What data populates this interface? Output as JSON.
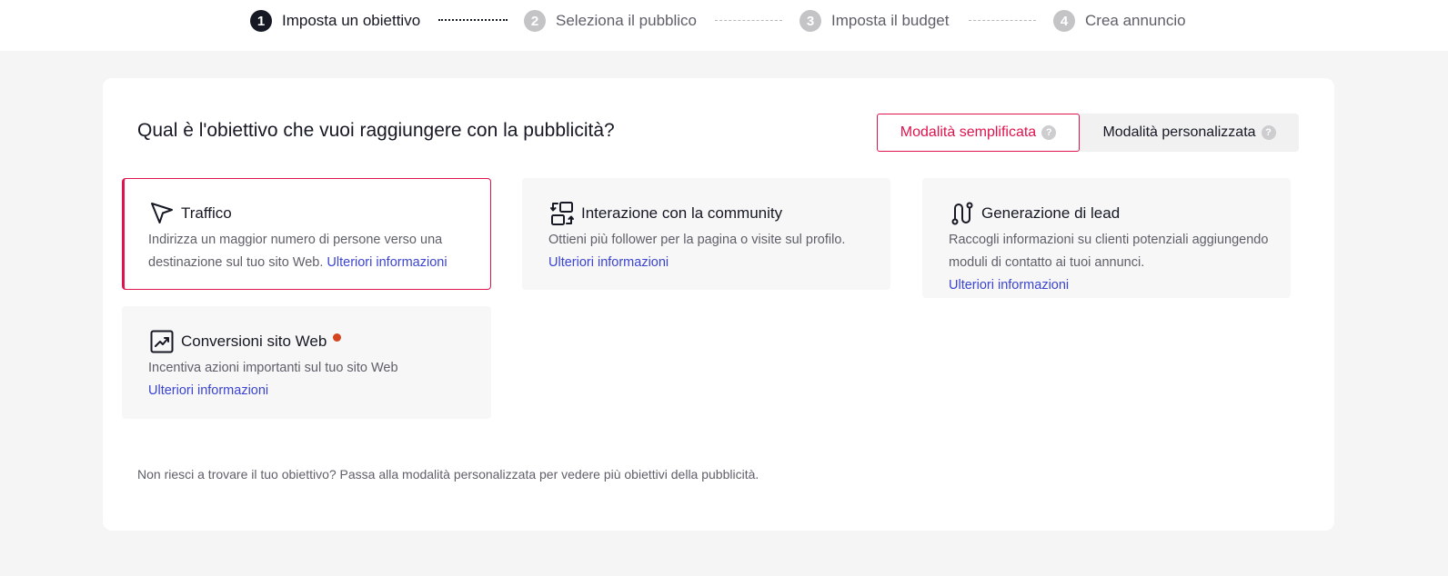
{
  "stepper": {
    "steps": [
      {
        "number": "1",
        "label": "Imposta un obiettivo"
      },
      {
        "number": "2",
        "label": "Seleziona il pubblico"
      },
      {
        "number": "3",
        "label": "Imposta il budget"
      },
      {
        "number": "4",
        "label": "Crea annuncio"
      }
    ]
  },
  "main": {
    "title": "Qual è l'obiettivo che vuoi raggiungere con la pubblicità?",
    "modes": {
      "simple_label": "Modalità semplificata",
      "custom_label": "Modalità personalizzata",
      "help_glyph": "?"
    },
    "objectives": [
      {
        "title": "Traffico",
        "icon": "cursor-arrow-icon",
        "description": "Indirizza un maggior numero di persone verso una destinazione sul tuo sito Web.",
        "link": "Ulteriori informazioni",
        "selected": true
      },
      {
        "title": "Interazione con la community",
        "icon": "community-interaction-icon",
        "description": "Ottieni più follower per la pagina o visite sul profilo.",
        "link": "Ulteriori informazioni"
      },
      {
        "title": "Generazione di lead",
        "icon": "lead-path-icon",
        "description": "Raccogli informazioni su clienti potenziali aggiungendo moduli di contatto ai tuoi annunci.",
        "link": "Ulteriori informazioni"
      },
      {
        "title": "Conversioni sito Web",
        "icon": "trending-chart-icon",
        "description": "Incentiva azioni importanti sul tuo sito Web",
        "link": "Ulteriori informazioni",
        "new_badge": true
      }
    ],
    "footnote": "Non riesci a trovare il tuo obiettivo? Passa alla modalità personalizzata per vedere più obiettivi della pubblicità."
  },
  "colors": {
    "accent": "#e0134d",
    "link": "#3b45d1",
    "new_dot": "#d4451f",
    "active_step": "#161823",
    "inactive_step": "#c4c4c6"
  }
}
